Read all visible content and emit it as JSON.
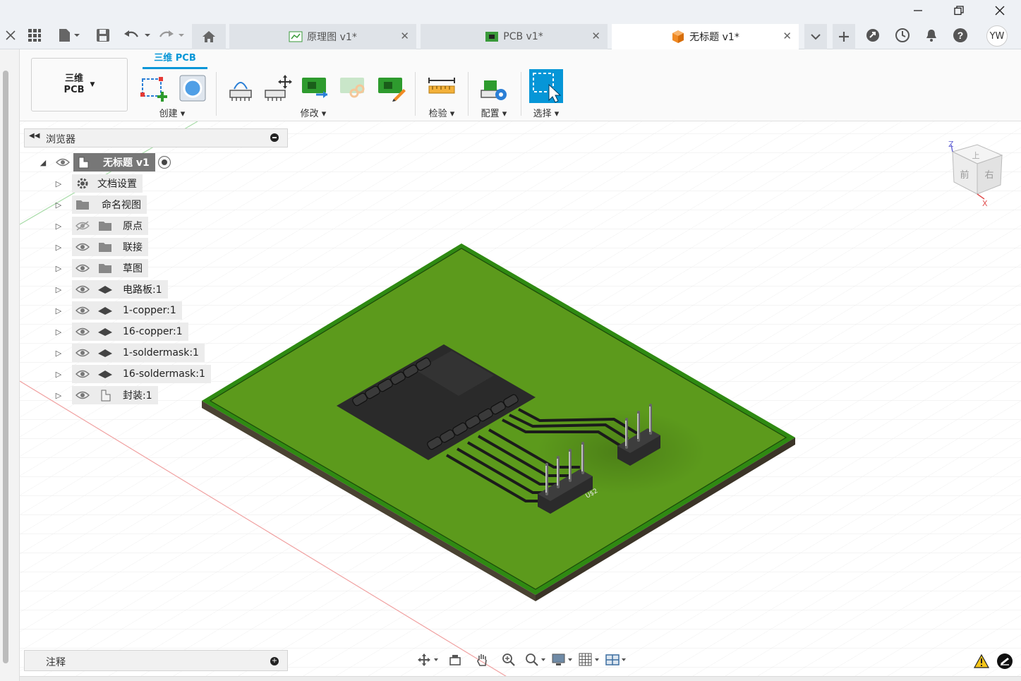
{
  "tabs": [
    {
      "label": "原理图 v1*",
      "icon": "schematic-icon"
    },
    {
      "label": "PCB v1*",
      "icon": "pcb-icon"
    },
    {
      "label": "无标题 v1*",
      "icon": "3d-box-icon"
    }
  ],
  "user": {
    "initials": "YW"
  },
  "workspace": {
    "label_line1": "三维",
    "label_line2": "PCB"
  },
  "ribbon": {
    "active_tab": "三维 PCB",
    "groups": [
      "创建",
      "修改",
      "检验",
      "配置",
      "选择"
    ]
  },
  "browser": {
    "title": "浏览器",
    "root": "无标题 v1",
    "items": [
      {
        "label": "文档设置",
        "icon": "gear-icon",
        "visibility": "none"
      },
      {
        "label": "命名视图",
        "icon": "folder-icon",
        "visibility": "none"
      },
      {
        "label": "原点",
        "icon": "folder-icon",
        "visibility": "hidden"
      },
      {
        "label": "联接",
        "icon": "folder-icon",
        "visibility": "visible"
      },
      {
        "label": "草图",
        "icon": "folder-icon",
        "visibility": "visible"
      },
      {
        "label": "电路板:1",
        "icon": "body-icon",
        "visibility": "visible"
      },
      {
        "label": "1-copper:1",
        "icon": "body-icon",
        "visibility": "visible"
      },
      {
        "label": "16-copper:1",
        "icon": "body-icon",
        "visibility": "visible"
      },
      {
        "label": "1-soldermask:1",
        "icon": "body-icon",
        "visibility": "visible"
      },
      {
        "label": "16-soldermask:1",
        "icon": "body-icon",
        "visibility": "visible"
      },
      {
        "label": "封装:1",
        "icon": "component-icon",
        "visibility": "visible"
      }
    ]
  },
  "viewcube": {
    "top": "上",
    "front": "前",
    "right": "右",
    "axis_x": "X",
    "axis_z": "Z"
  },
  "board": {
    "label": "U$2"
  },
  "notes": {
    "title": "注释"
  },
  "colors": {
    "accent": "#0696d7",
    "board": "#5c9a1c",
    "board_edge": "#2f8a12",
    "chip": "#2a2a2a"
  }
}
